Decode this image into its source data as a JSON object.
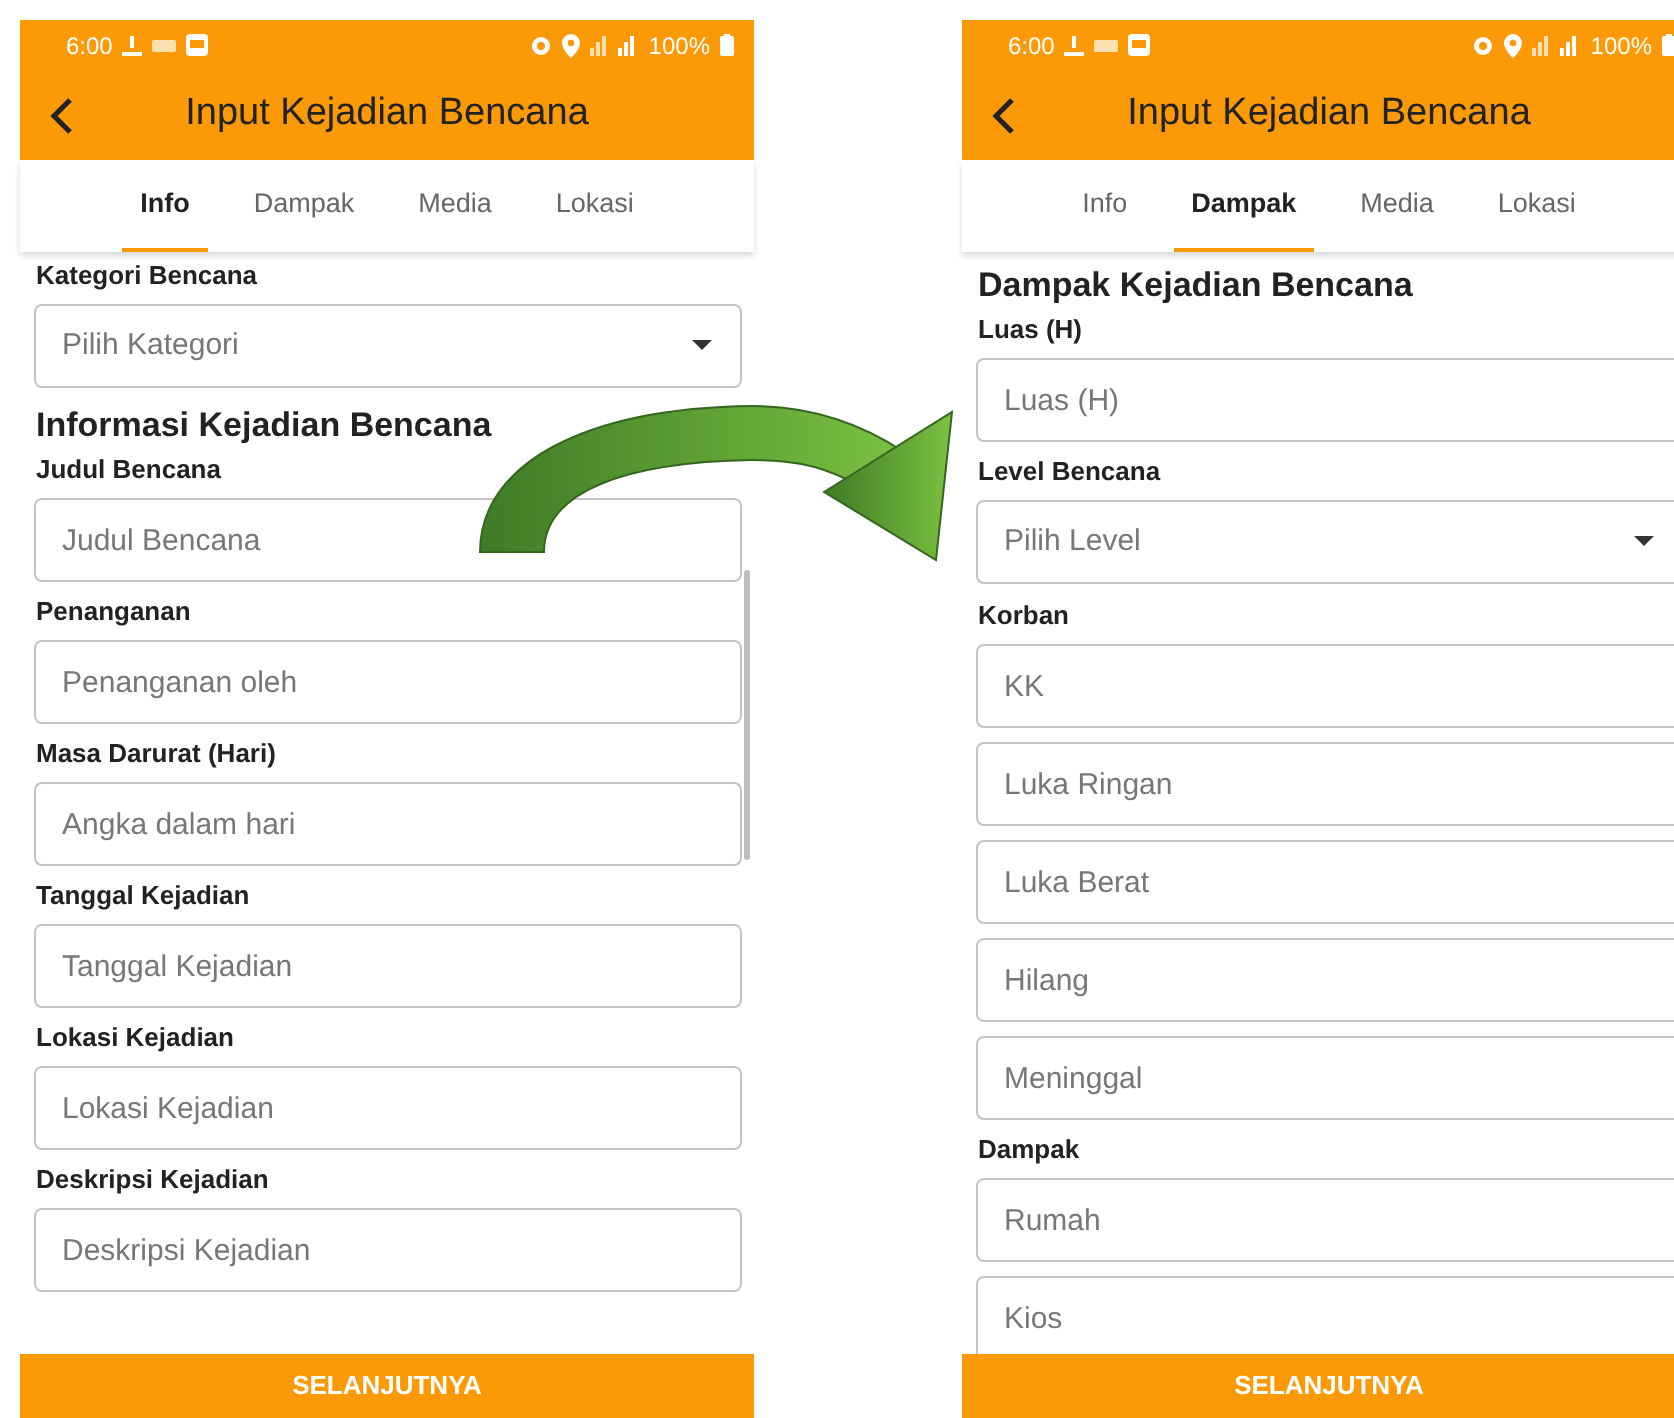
{
  "screens": [
    {
      "status_bar": {
        "time": "6:00",
        "battery": "100%"
      },
      "title": "Input Kejadian Bencana",
      "tabs": [
        {
          "label": "Info",
          "selected": true
        },
        {
          "label": "Dampak",
          "selected": false
        },
        {
          "label": "Media",
          "selected": false
        },
        {
          "label": "Lokasi",
          "selected": false
        }
      ],
      "form": [
        {
          "kind": "label",
          "text": "Kategori Bencana"
        },
        {
          "kind": "select",
          "placeholder": "Pilih Kategori"
        },
        {
          "kind": "heading",
          "text": "Informasi Kejadian Bencana"
        },
        {
          "kind": "label",
          "text": "Judul Bencana"
        },
        {
          "kind": "input",
          "placeholder": "Judul Bencana"
        },
        {
          "kind": "label",
          "text": "Penanganan"
        },
        {
          "kind": "input",
          "placeholder": "Penanganan oleh"
        },
        {
          "kind": "label",
          "text": "Masa Darurat (Hari)"
        },
        {
          "kind": "input",
          "placeholder": "Angka dalam hari"
        },
        {
          "kind": "label",
          "text": "Tanggal Kejadian"
        },
        {
          "kind": "input",
          "placeholder": "Tanggal Kejadian"
        },
        {
          "kind": "label",
          "text": "Lokasi Kejadian"
        },
        {
          "kind": "input",
          "placeholder": "Lokasi Kejadian"
        },
        {
          "kind": "label",
          "text": "Deskripsi Kejadian"
        },
        {
          "kind": "input",
          "placeholder": "Deskripsi Kejadian"
        }
      ],
      "button": "SELANJUTNYA"
    },
    {
      "status_bar": {
        "time": "6:00",
        "battery": "100%"
      },
      "title": "Input Kejadian Bencana",
      "tabs": [
        {
          "label": "Info",
          "selected": false
        },
        {
          "label": "Dampak",
          "selected": true
        },
        {
          "label": "Media",
          "selected": false
        },
        {
          "label": "Lokasi",
          "selected": false
        }
      ],
      "form": [
        {
          "kind": "heading",
          "text": "Dampak Kejadian Bencana"
        },
        {
          "kind": "label",
          "text": "Luas (H)"
        },
        {
          "kind": "input",
          "placeholder": "Luas (H)"
        },
        {
          "kind": "label",
          "text": "Level Bencana"
        },
        {
          "kind": "select",
          "placeholder": "Pilih Level"
        },
        {
          "kind": "label",
          "text": "Korban"
        },
        {
          "kind": "input",
          "placeholder": "KK"
        },
        {
          "kind": "input",
          "placeholder": "Luka Ringan"
        },
        {
          "kind": "input",
          "placeholder": "Luka Berat"
        },
        {
          "kind": "input",
          "placeholder": "Hilang"
        },
        {
          "kind": "input",
          "placeholder": "Meninggal"
        },
        {
          "kind": "label",
          "text": "Dampak"
        },
        {
          "kind": "input",
          "placeholder": "Rumah"
        },
        {
          "kind": "input",
          "placeholder": "Kios"
        }
      ],
      "button": "SELANJUTNYA"
    }
  ]
}
